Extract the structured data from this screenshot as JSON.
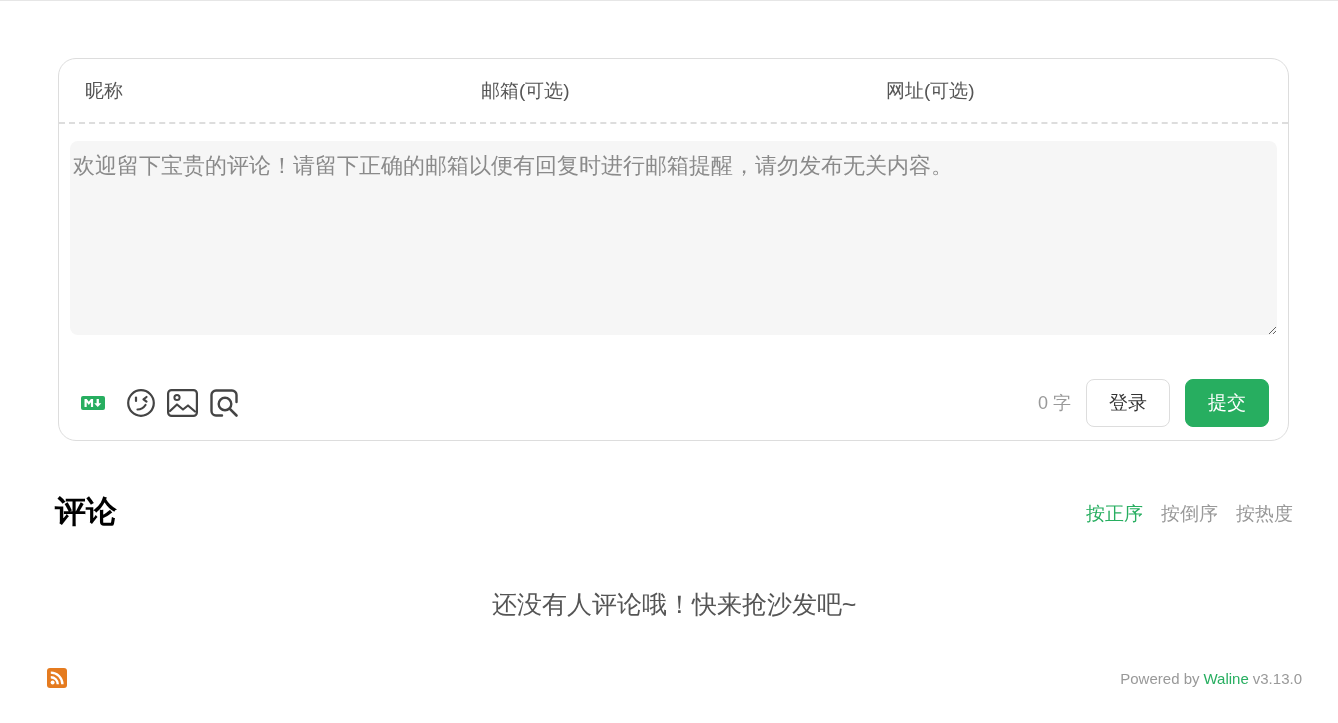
{
  "comment_form": {
    "fields": [
      {
        "label": "昵称"
      },
      {
        "label": "邮箱(可选)"
      },
      {
        "label": "网址(可选)"
      }
    ],
    "editor": {
      "placeholder": "欢迎留下宝贵的评论！请留下正确的邮箱以便有回复时进行邮箱提醒，请勿发布无关内容。"
    },
    "word_count": "0 字",
    "buttons": [
      {
        "label": "登录",
        "kind": "secondary"
      },
      {
        "label": "提交",
        "kind": "primary"
      }
    ]
  },
  "comments": {
    "title": "评论",
    "sort_tabs": [
      {
        "label": "按正序",
        "selected": true
      },
      {
        "label": "按倒序",
        "selected": false
      },
      {
        "label": "按热度",
        "selected": false
      }
    ],
    "empty_message": "还没有人评论哦！快来抢沙发吧~"
  },
  "footer": {
    "powered_by": "Powered by",
    "link": "Waline",
    "version": "v3.13.0"
  }
}
